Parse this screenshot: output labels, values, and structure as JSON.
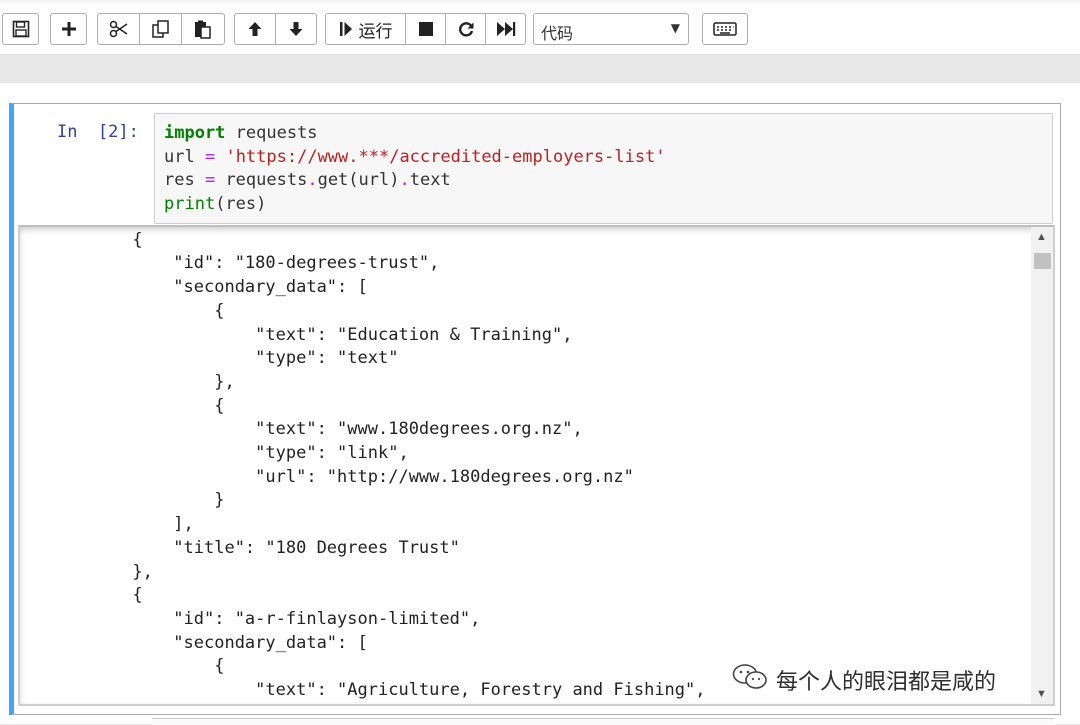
{
  "toolbar": {
    "buttons": [
      {
        "icon": "save-icon"
      },
      {
        "icon": "plus-icon"
      },
      {
        "icon": "scissors-icon"
      },
      {
        "icon": "copy-icon"
      },
      {
        "icon": "paste-icon"
      },
      {
        "icon": "arrow-up-icon"
      },
      {
        "icon": "arrow-down-icon"
      },
      {
        "icon": "step-play-icon",
        "label": "运行"
      },
      {
        "icon": "stop-icon"
      },
      {
        "icon": "restart-icon"
      },
      {
        "icon": "fast-forward-icon"
      },
      {
        "icon": "keyboard-icon"
      }
    ],
    "run_label": "运行",
    "cell_type": "代码"
  },
  "cell": {
    "prompt": "In  [2]:",
    "input_lines": [
      [
        {
          "t": "import",
          "c": "kw"
        },
        {
          "t": " requests",
          "c": ""
        }
      ],
      [
        {
          "t": "url ",
          "c": ""
        },
        {
          "t": "=",
          "c": "op"
        },
        {
          "t": " ",
          "c": ""
        },
        {
          "t": "'https://www.***/accredited-employers-list'",
          "c": "str"
        }
      ],
      [
        {
          "t": "res ",
          "c": ""
        },
        {
          "t": "=",
          "c": "op"
        },
        {
          "t": " requests",
          "c": ""
        },
        {
          "t": ".",
          "c": "op"
        },
        {
          "t": "get(url)",
          "c": ""
        },
        {
          "t": ".",
          "c": "op"
        },
        {
          "t": "text",
          "c": ""
        }
      ],
      [
        {
          "t": "print",
          "c": "bi"
        },
        {
          "t": "(res)",
          "c": ""
        }
      ]
    ],
    "output_lines": [
      "          },",
      "          {",
      "              \"id\": \"180-degrees-trust\",",
      "              \"secondary_data\": [",
      "                  {",
      "                      \"text\": \"Education & Training\",",
      "                      \"type\": \"text\"",
      "                  },",
      "                  {",
      "                      \"text\": \"www.180degrees.org.nz\",",
      "                      \"type\": \"link\",",
      "                      \"url\": \"http://www.180degrees.org.nz\"",
      "                  }",
      "              ],",
      "              \"title\": \"180 Degrees Trust\"",
      "          },",
      "          {",
      "              \"id\": \"a-r-finlayson-limited\",",
      "              \"secondary_data\": [",
      "                  {",
      "                      \"text\": \"Agriculture, Forestry and Fishing\","
    ]
  },
  "watermark": {
    "icon": "wechat-icon",
    "text": "每个人的眼泪都是咸的"
  }
}
